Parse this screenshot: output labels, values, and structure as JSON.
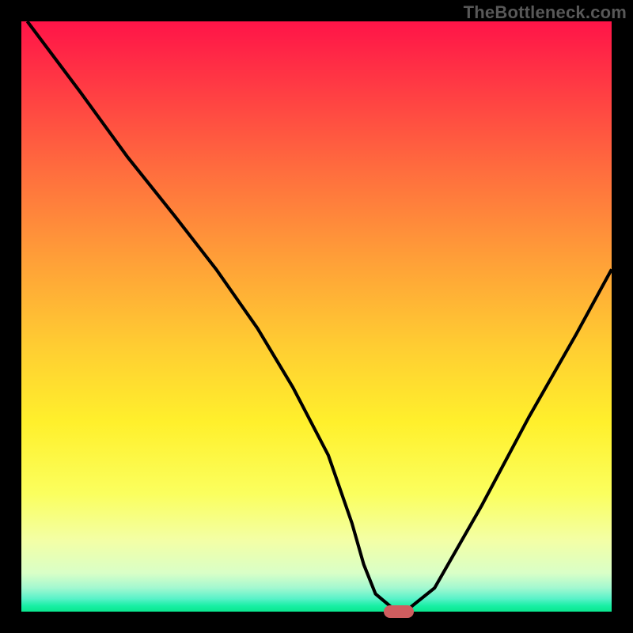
{
  "watermark": "TheBottleneck.com",
  "marker_color": "#cf5d5f",
  "chart_data": {
    "type": "line",
    "title": "",
    "xlabel": "",
    "ylabel": "",
    "xlim": [
      0,
      100
    ],
    "ylim": [
      0,
      100
    ],
    "grid": false,
    "legend": false,
    "background_gradient_stops": [
      {
        "at": 0.0,
        "color": "#ff1448"
      },
      {
        "at": 0.1,
        "color": "#ff3744"
      },
      {
        "at": 0.25,
        "color": "#ff6c3e"
      },
      {
        "at": 0.4,
        "color": "#ff9e38"
      },
      {
        "at": 0.55,
        "color": "#ffcd32"
      },
      {
        "at": 0.68,
        "color": "#fff02c"
      },
      {
        "at": 0.8,
        "color": "#fbff5e"
      },
      {
        "at": 0.88,
        "color": "#f3ffa6"
      },
      {
        "at": 0.935,
        "color": "#d9ffc7"
      },
      {
        "at": 0.96,
        "color": "#a2f8d0"
      },
      {
        "at": 0.978,
        "color": "#59f2c9"
      },
      {
        "at": 0.99,
        "color": "#19efa5"
      },
      {
        "at": 1.0,
        "color": "#0ae78e"
      }
    ],
    "series": [
      {
        "name": "bottleneck-curve",
        "x": [
          1,
          10,
          18,
          26,
          33,
          40,
          46,
          52,
          56,
          58,
          60,
          63,
          65,
          70,
          78,
          86,
          94,
          100
        ],
        "y": [
          100,
          88,
          77,
          67,
          58,
          48,
          38,
          26.5,
          15,
          8,
          3,
          0.5,
          0,
          4,
          18,
          33,
          47,
          58
        ]
      }
    ],
    "marker": {
      "x": 64,
      "y": 0
    }
  }
}
